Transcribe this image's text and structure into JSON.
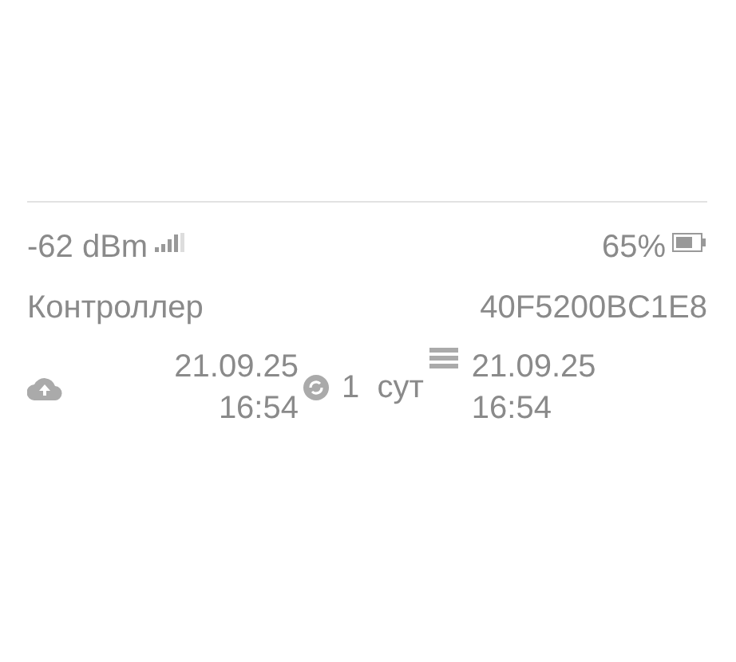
{
  "signal": {
    "reading": "-62 dBm"
  },
  "battery": {
    "reading": "65%"
  },
  "device": {
    "name": "Контроллер",
    "id": "40F5200BC1E8"
  },
  "sync": {
    "last_upload": {
      "date": "21.09.25",
      "time": "16:54"
    },
    "period": "1  сут",
    "last_record": {
      "date": "21.09.25",
      "time": "16:54"
    }
  }
}
